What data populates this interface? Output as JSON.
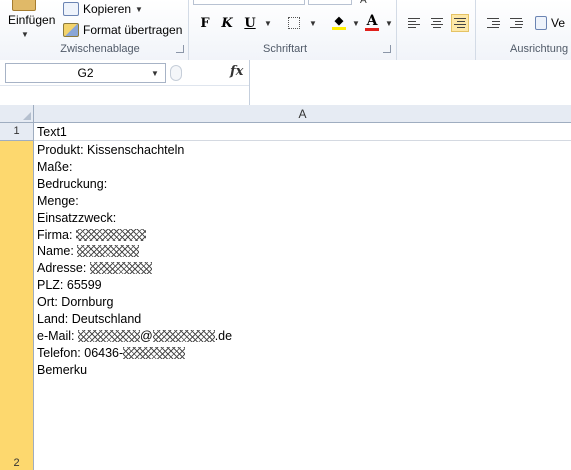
{
  "ribbon": {
    "clipboard": {
      "paste_label": "Einfügen",
      "copy_label": "Kopieren",
      "format_painter_label": "Format übertragen",
      "group_label": "Zwischenablage"
    },
    "font": {
      "group_label": "Schriftart",
      "bold_label": "F",
      "italic_label": "K",
      "underline_label": "U",
      "font_color_label": "A"
    },
    "alignment": {
      "group_label": "Ausrichtung",
      "wrap_partial_label": "Ve"
    }
  },
  "formula_bar": {
    "name_box_value": "G2",
    "fx_label": "fx",
    "formula_value": ""
  },
  "sheet": {
    "column_header": "A",
    "rows": [
      {
        "number": "1",
        "text": "Text1"
      },
      {
        "number": "2"
      }
    ],
    "cell_a2_lines": [
      {
        "label": "Produkt: Kissenschachteln",
        "redacted": false
      },
      {
        "label": "Maße:",
        "redacted": false
      },
      {
        "label": "Bedruckung:",
        "redacted": false
      },
      {
        "label": "Menge:",
        "redacted": false
      },
      {
        "label": "Einsatzzweck:",
        "redacted": false
      },
      {
        "label": "Firma: ",
        "redacted": true
      },
      {
        "label": "Name: ",
        "redacted": true
      },
      {
        "label": "Adresse: ",
        "redacted": true
      },
      {
        "label": "PLZ: 65599",
        "redacted": false
      },
      {
        "label": "Ort: Dornburg",
        "redacted": false
      },
      {
        "label": "Land: Deutschland",
        "redacted": false
      },
      {
        "label": "e-Mail: ",
        "redacted": true,
        "suffix_redact": true,
        "suffix": ".de",
        "middle": "@"
      },
      {
        "label": "Telefon: 06436-",
        "redacted": true
      },
      {
        "label": "Bemerku",
        "redacted": false
      }
    ]
  },
  "colors": {
    "selected_row_header": "#fdd86e",
    "header_bg": "#e6ebf3",
    "font_color_underline": "#e0211c",
    "highlight_underline": "#ffee00"
  }
}
